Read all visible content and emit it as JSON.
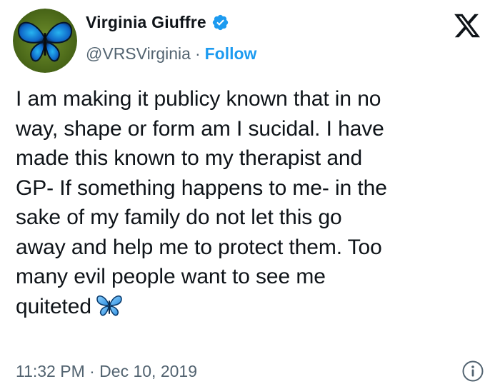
{
  "author": {
    "display_name": "Virginia Giuffre",
    "handle": "@VRSVirginia",
    "separator": "·",
    "follow_label": "Follow",
    "verified": true,
    "avatar_icon": "blue-butterfly-avatar"
  },
  "platform": {
    "logo_icon": "x-logo-icon"
  },
  "tweet": {
    "text": "I am making it publicy known that in no\nway, shape or form am I sucidal. I have\nmade this known to my therapist and\nGP- If something happens to me- in the\nsake of my family do not let this go\naway and help me to protect them. Too\nmany evil people want to see me\nquiteted",
    "emoji_icon": "butterfly-emoji-icon"
  },
  "footer": {
    "timestamp": "11:32 PM · Dec 10, 2019",
    "info_icon": "info-icon"
  },
  "colors": {
    "text": "#0f1419",
    "secondary": "#536471",
    "accent": "#1d9bf0"
  }
}
